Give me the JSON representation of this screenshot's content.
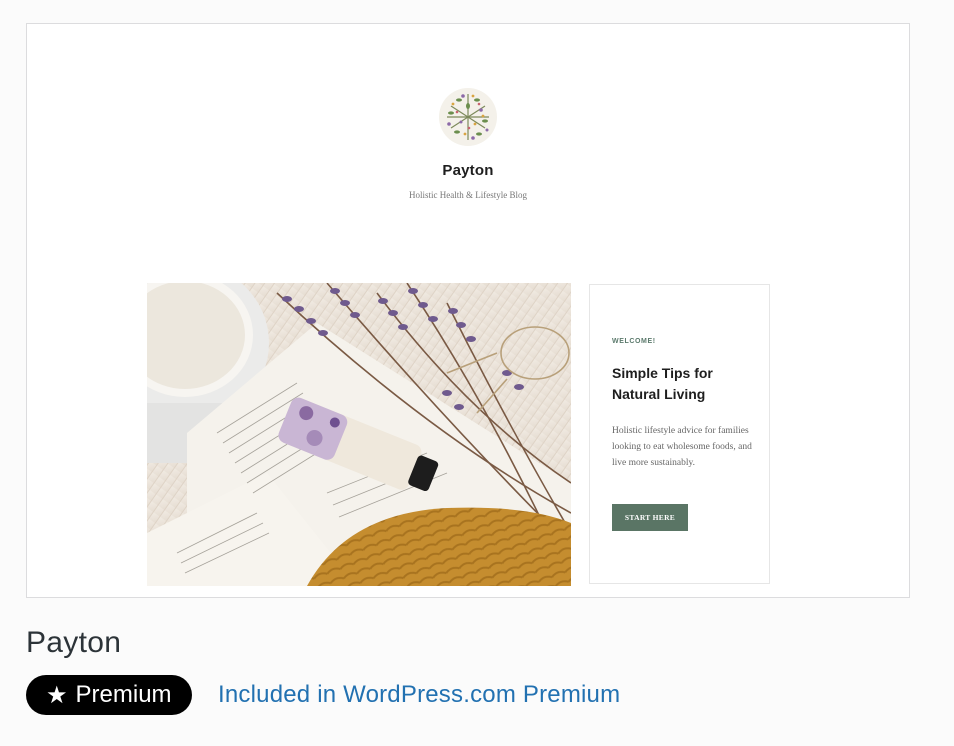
{
  "preview": {
    "site_title": "Payton",
    "site_tagline": "Holistic Health & Lifestyle Blog",
    "logo_icon": "botanical-wreath-icon",
    "hero_image": "lavender-book-lotion-flatlay",
    "welcome": {
      "eyebrow": "WELCOME!",
      "heading": "Simple Tips for Natural Living",
      "body": "Holistic lifestyle advice for families looking to eat wholesome foods, and live more sustainably.",
      "cta_label": "START HERE"
    }
  },
  "theme": {
    "name": "Payton",
    "badge_label": "Premium",
    "badge_icon": "star-icon",
    "included_text": "Included in WordPress.com Premium"
  },
  "colors": {
    "badge_bg": "#000000",
    "link": "#2271b1",
    "cta_bg": "#5a7565",
    "eyebrow": "#5b7a6c"
  }
}
